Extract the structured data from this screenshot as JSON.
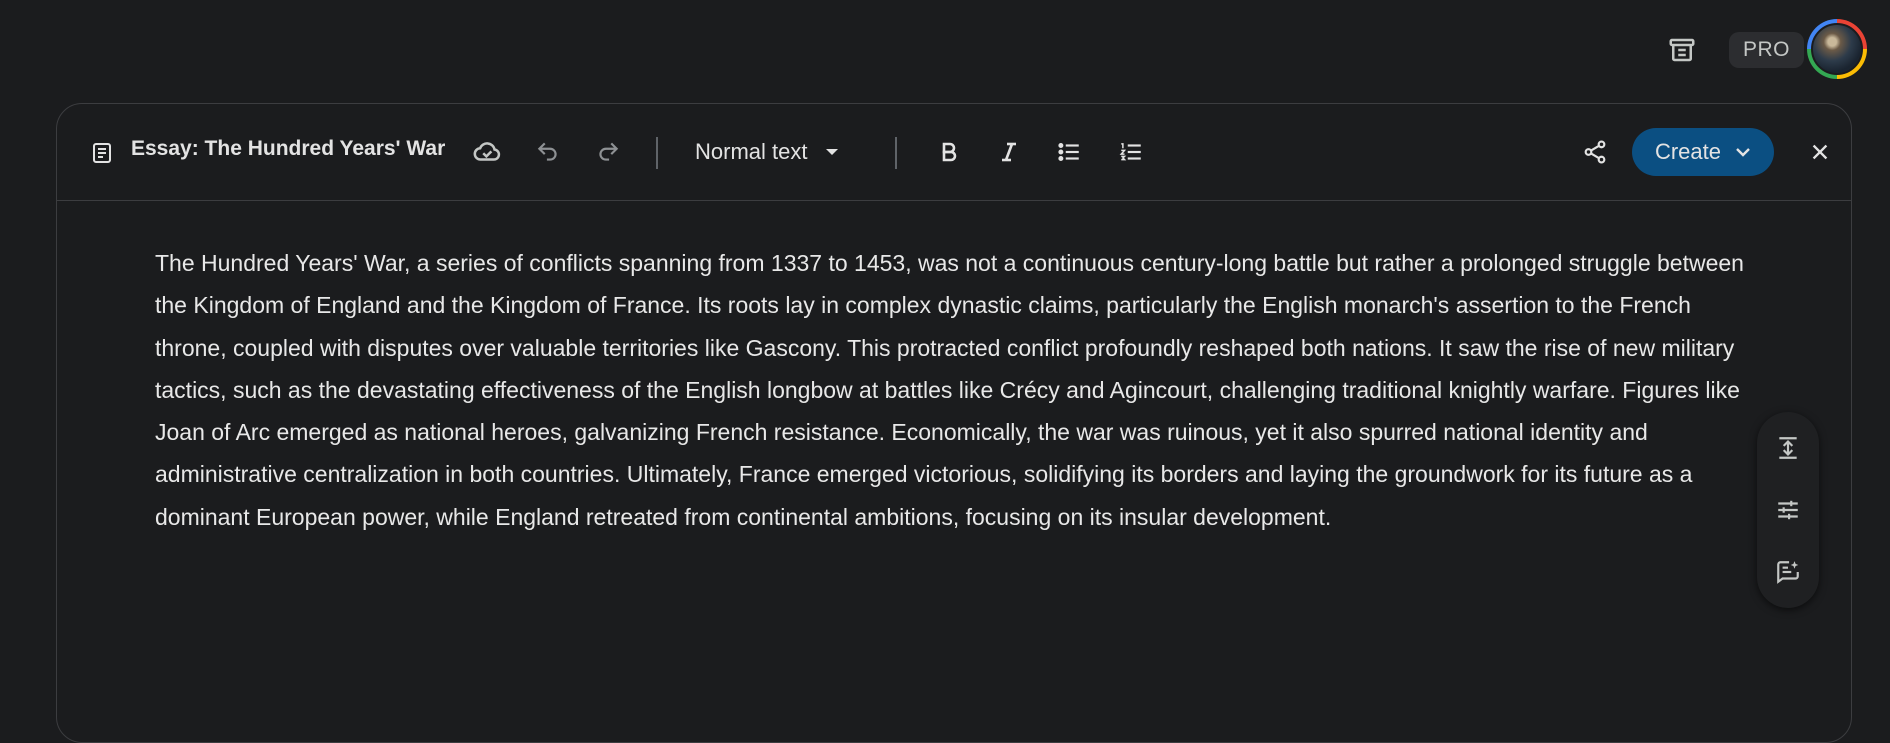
{
  "header": {
    "pro_badge": "PRO",
    "icons": {
      "archive": "archive-icon",
      "avatar": "user-avatar"
    }
  },
  "toolbar": {
    "doc_title": "Essay: The Hundred Years' War",
    "text_style": "Normal text",
    "create_label": "Create",
    "icons": [
      "document-icon",
      "cloud-done-icon",
      "undo-icon",
      "redo-icon",
      "dropdown-arrow-icon",
      "bold-icon",
      "italic-icon",
      "bulleted-list-icon",
      "numbered-list-icon",
      "share-icon",
      "chevron-down-icon",
      "close-icon"
    ]
  },
  "document": {
    "body": "The Hundred Years' War, a series of conflicts spanning from 1337 to 1453, was not a continuous century-long battle but rather a prolonged struggle between the Kingdom of England and the Kingdom of France. Its roots lay in complex dynastic claims, particularly the English monarch's assertion to the French throne, coupled with disputes over valuable territories like Gascony. This protracted conflict profoundly reshaped both nations. It saw the rise of new military tactics, such as the devastating effectiveness of the English longbow at battles like Crécy and Agincourt, challenging traditional knightly warfare. Figures like Joan of Arc emerged as national heroes, galvanizing French resistance. Economically, the war was ruinous, yet it also spurred national identity and administrative centralization in both countries. Ultimately, France emerged victorious, solidifying its borders and laying the groundwork for its future as a dominant European power, while England retreated from continental ambitions, focusing on its insular development."
  },
  "side_panel": {
    "icons": [
      "adjust-length-icon",
      "tune-icon",
      "suggest-edits-icon"
    ]
  }
}
